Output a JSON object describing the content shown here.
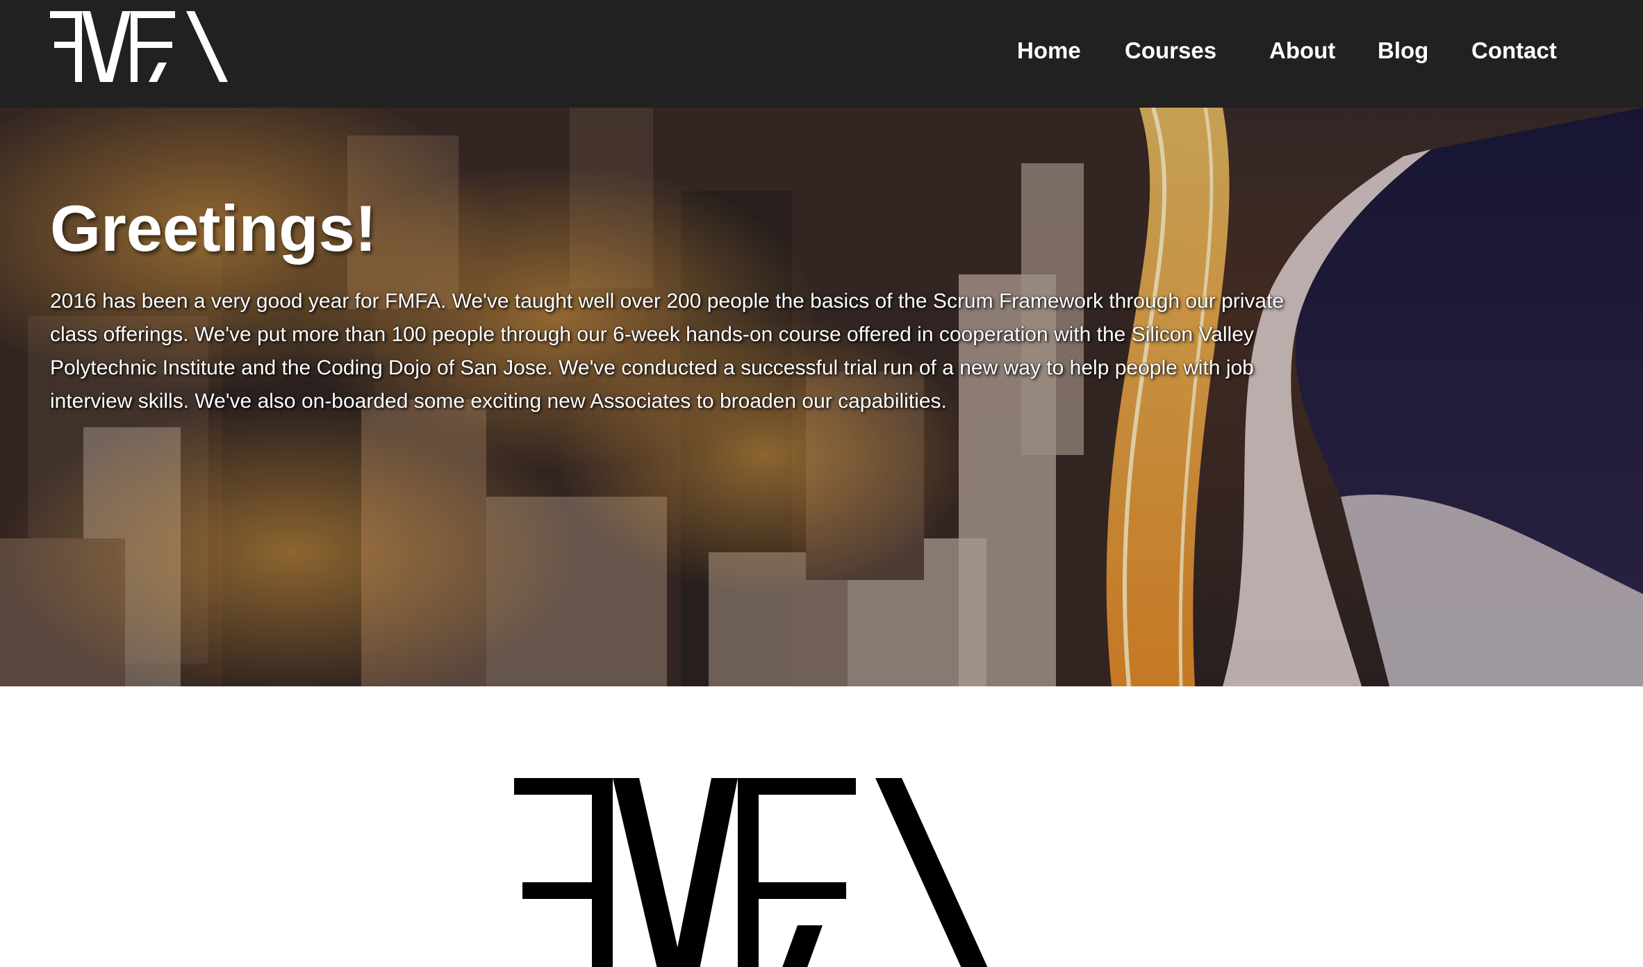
{
  "brand": {
    "name": "FMFA"
  },
  "nav": {
    "items": [
      {
        "label": "Home"
      },
      {
        "label": "Courses"
      },
      {
        "label": "About"
      },
      {
        "label": "Blog"
      },
      {
        "label": "Contact"
      }
    ]
  },
  "hero": {
    "title": "Greetings!",
    "body": "2016 has been a very good year for FMFA. We've taught well over 200 people the basics of the Scrum Framework through our private class offerings. We've put more than 100 people through our 6-week hands-on course offered in cooperation with the Silicon Valley Polytechnic Institute and the Coding Dojo of San Jose. We've conducted a successful trial run of a new way to help people with job interview skills. We've also on-boarded some exciting new Associates to broaden our capabilities."
  },
  "colors": {
    "header_bg": "#212121",
    "nav_text": "#ffffff",
    "hero_text": "#ffffff",
    "city_glow": "#f5a623",
    "lake": "#232142",
    "logo_dark": "#000000"
  },
  "icons": {
    "header_logo": "fmfa-logo-icon",
    "main_logo": "fmfa-logo-icon"
  }
}
